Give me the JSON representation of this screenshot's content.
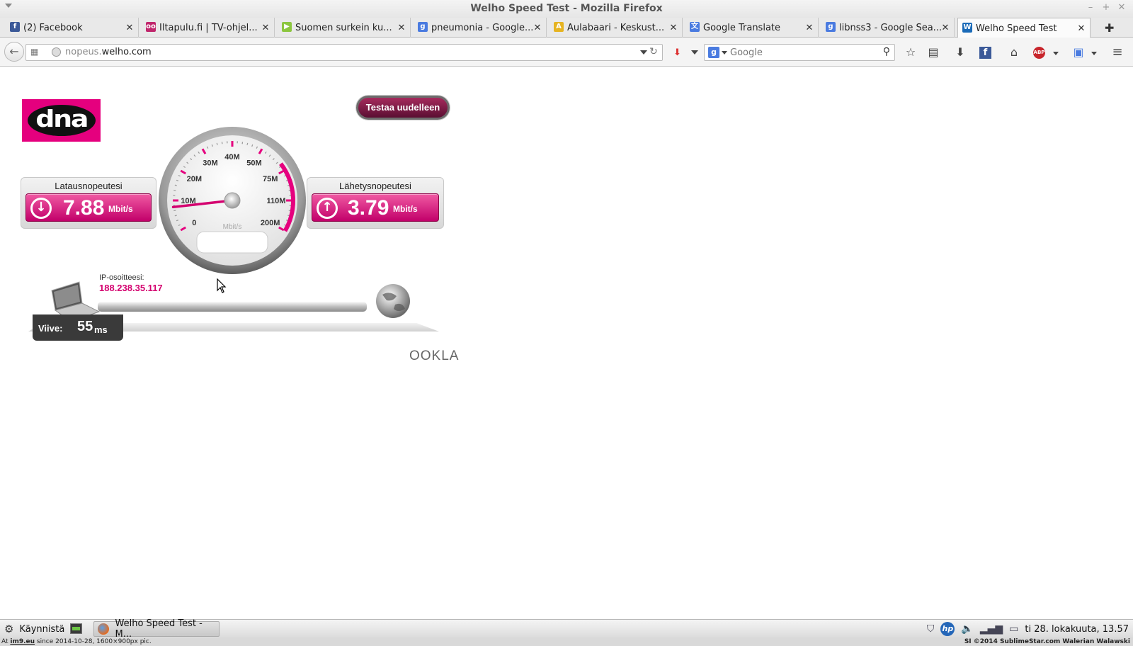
{
  "window": {
    "title": "Welho Speed Test - Mozilla Firefox"
  },
  "tabs": [
    {
      "label": "(2) Facebook",
      "icon": "facebook-icon",
      "color": "#3b5998",
      "glyph": "f"
    },
    {
      "label": "Iltapulu.fi | TV-ohjel...",
      "icon": "iltapulu-icon",
      "color": "#c0266c",
      "glyph": "oo"
    },
    {
      "label": "Suomen surkein ku...",
      "icon": "play-icon",
      "color": "#8cc63f",
      "glyph": "▶"
    },
    {
      "label": "pneumonia - Google...",
      "icon": "google-icon",
      "color": "#4a7be0",
      "glyph": "g"
    },
    {
      "label": "Aulabaari - Keskust...",
      "icon": "aulabaari-icon",
      "color": "#e6b422",
      "glyph": "A"
    },
    {
      "label": "Google Translate",
      "icon": "translate-icon",
      "color": "#4a7be0",
      "glyph": "文"
    },
    {
      "label": "libnss3 - Google Sea...",
      "icon": "google-icon",
      "color": "#4a7be0",
      "glyph": "g"
    },
    {
      "label": "Welho Speed Test",
      "icon": "welho-icon",
      "color": "#1b6bb8",
      "glyph": "W",
      "active": true
    }
  ],
  "navbar": {
    "url_sub": "nopeus.",
    "url_domain": "welho.com",
    "search_placeholder": "Google"
  },
  "speedtest": {
    "retest_label": "Testaa uudelleen",
    "download": {
      "title": "Latausnopeutesi",
      "value": "7.88",
      "unit": "Mbit/s"
    },
    "upload": {
      "title": "Lähetysnopeutesi",
      "value": "3.79",
      "unit": "Mbit/s"
    },
    "gauge": {
      "unit_label": "Mbit/s",
      "ticks": [
        "0",
        "10M",
        "20M",
        "30M",
        "40M",
        "50M",
        "75M",
        "110M",
        "200M"
      ],
      "needle_value": 7.88
    },
    "ip_label": "IP-osoitteesi:",
    "ip_value": "188.238.35.117",
    "ping_label": "Viive:",
    "ping_value": "55",
    "ping_unit": "ms",
    "brand": "DNA",
    "provider": "OOKLA",
    "accent_color": "#e5007e"
  },
  "taskbar": {
    "start_label": "Käynnistä",
    "task_label": "Welho Speed Test - M...",
    "clock": "ti 28. lokakuuta, 13.57"
  },
  "credit": {
    "left_prefix": "At ",
    "left_site": "im9.eu",
    "left_rest": " since 2014-10-28, 1600×900px pic.",
    "right": "SI ©2014 SublimeStar.com Walerian Walawski"
  }
}
